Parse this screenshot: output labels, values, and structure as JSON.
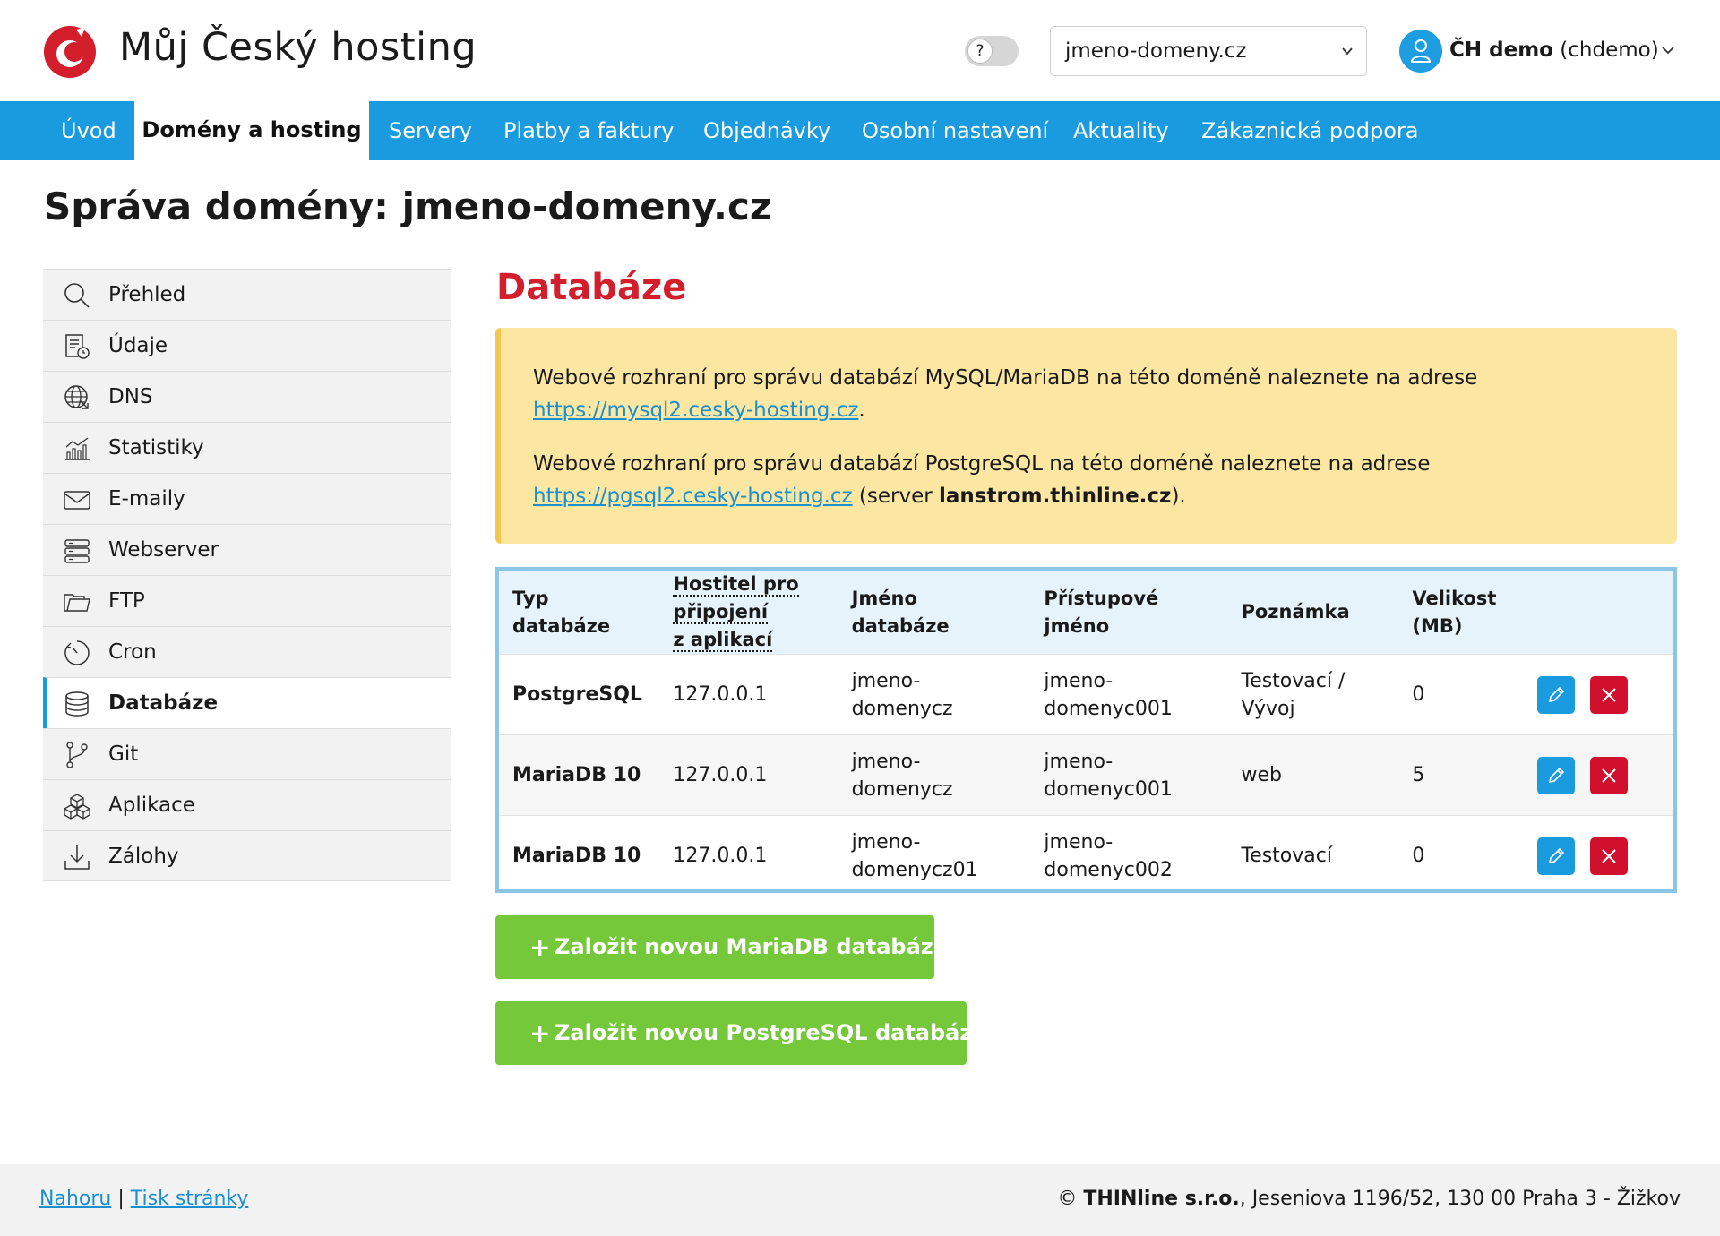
{
  "brand": {
    "name": "Můj Český hosting",
    "accent": "#1b9bdf",
    "logo_color": "#d31f2c"
  },
  "header": {
    "help_label": "?",
    "domain_select": "jmeno-domeny.cz",
    "user_bold": "ČH demo",
    "user_login": "(chdemo)"
  },
  "nav": {
    "items": [
      "Úvod",
      "Domény a hosting",
      "Servery",
      "Platby a faktury",
      "Objednávky",
      "Osobní nastavení",
      "Aktuality",
      "Zákaznická podpora"
    ],
    "active": "Domény a hosting"
  },
  "page_title": "Správa domény: jmeno-domeny.cz",
  "sidebar": {
    "items": [
      {
        "label": "Přehled",
        "icon": "search-icon"
      },
      {
        "label": "Údaje",
        "icon": "document-icon"
      },
      {
        "label": "DNS",
        "icon": "globe-icon"
      },
      {
        "label": "Statistiky",
        "icon": "chart-icon"
      },
      {
        "label": "E-maily",
        "icon": "envelope-icon"
      },
      {
        "label": "Webserver",
        "icon": "server-icon"
      },
      {
        "label": "FTP",
        "icon": "folder-icon"
      },
      {
        "label": "Cron",
        "icon": "clock-icon"
      },
      {
        "label": "Databáze",
        "icon": "database-icon"
      },
      {
        "label": "Git",
        "icon": "git-branch-icon"
      },
      {
        "label": "Aplikace",
        "icon": "cubes-icon"
      },
      {
        "label": "Zálohy",
        "icon": "download-icon"
      }
    ],
    "active": "Databáze"
  },
  "section_title": "Databáze",
  "notice": {
    "p1_text": "Webové rozhraní pro správu databází MySQL/MariaDB na této doméně naleznete na adrese ",
    "p1_link": "https://mysql2.cesky-hosting.cz",
    "p1_end": ".",
    "p2_text": "Webové rozhraní pro správu databází PostgreSQL na této doméně naleznete na adrese ",
    "p2_link": "https://pgsql2.cesky-hosting.cz",
    "p2_mid": " (server ",
    "p2_server": "lanstrom.thinline.cz",
    "p2_end": ")."
  },
  "table": {
    "headers": {
      "type": [
        "Typ",
        "databáze"
      ],
      "host": [
        "Hostitel pro připojení",
        "z aplikací"
      ],
      "dbname": [
        "Jméno",
        "databáze"
      ],
      "login": [
        "Přístupové",
        "jméno"
      ],
      "note": "Poznámka",
      "size": [
        "Velikost",
        "(MB)"
      ]
    },
    "rows": [
      {
        "type": "PostgreSQL",
        "host": "127.0.0.1",
        "dbname": [
          "jmeno-",
          "domenycz"
        ],
        "login": [
          "jmeno-",
          "domenyc001"
        ],
        "note": [
          "Testovací /",
          "Vývoj"
        ],
        "size": "0"
      },
      {
        "type": "MariaDB 10",
        "host": "127.0.0.1",
        "dbname": [
          "jmeno-",
          "domenycz"
        ],
        "login": [
          "jmeno-",
          "domenyc001"
        ],
        "note": [
          "web",
          ""
        ],
        "size": "5"
      },
      {
        "type": "MariaDB 10",
        "host": "127.0.0.1",
        "dbname": [
          "jmeno-",
          "domenycz01"
        ],
        "login": [
          "jmeno-",
          "domenyc002"
        ],
        "note": [
          "Testovací",
          ""
        ],
        "size": "0"
      }
    ]
  },
  "buttons": {
    "new_mariadb": "Založit novou MariaDB databázi",
    "new_postgres": "Založit novou PostgreSQL databázi",
    "plus": "+"
  },
  "footer": {
    "top_link": "Nahoru",
    "separator": "|",
    "print_link": "Tisk stránky",
    "copyright": "©",
    "company": "THINline s.r.o.",
    "address": ", Jeseniova 1196/52, 130 00 Praha 3 - Žižkov"
  }
}
